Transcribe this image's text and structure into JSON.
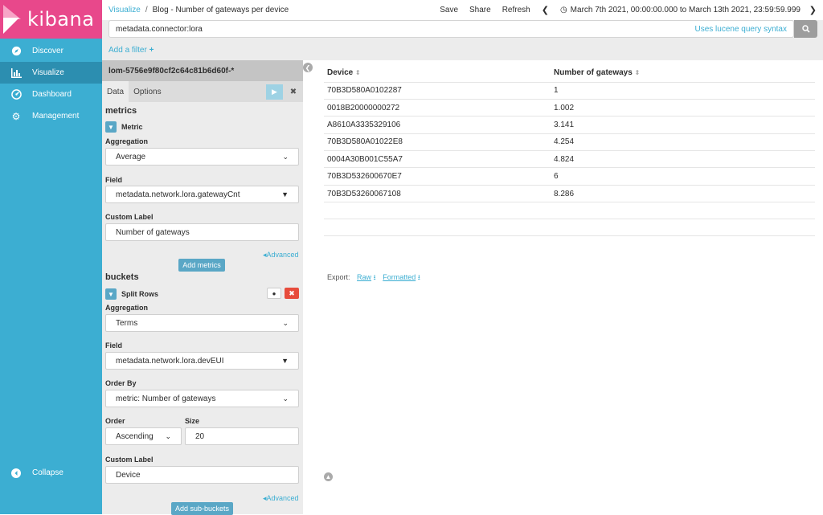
{
  "brand": {
    "name": "kibana"
  },
  "nav": [
    {
      "label": "Discover",
      "icon": "compass-icon"
    },
    {
      "label": "Visualize",
      "icon": "bar-chart-icon"
    },
    {
      "label": "Dashboard",
      "icon": "dashboard-icon"
    },
    {
      "label": "Management",
      "icon": "gear-icon"
    }
  ],
  "collapse_label": "Collapse",
  "breadcrumb": {
    "root": "Visualize",
    "separator": "/",
    "current": "Blog - Number of gateways per device"
  },
  "toolbar": {
    "save": "Save",
    "share": "Share",
    "refresh": "Refresh",
    "time_range": "March 7th 2021, 00:00:00.000 to March 13th 2021, 23:59:59.999"
  },
  "query": {
    "value": "metadata.connector:lora",
    "syntax_link": "Uses lucene query syntax"
  },
  "add_filter": "Add a filter",
  "editor": {
    "index_pattern": "lom-5756e9f80cf2c64c81b6d60f-*",
    "tabs": [
      "Data",
      "Options"
    ],
    "metrics_title": "metrics",
    "metric": {
      "header": "Metric",
      "aggregation_label": "Aggregation",
      "aggregation_value": "Average",
      "field_label": "Field",
      "field_value": "metadata.network.lora.gatewayCnt",
      "custom_label_label": "Custom Label",
      "custom_label_value": "Number of gateways",
      "advanced": "Advanced"
    },
    "add_metrics": "Add metrics",
    "buckets_title": "buckets",
    "bucket": {
      "header": "Split Rows",
      "aggregation_label": "Aggregation",
      "aggregation_value": "Terms",
      "field_label": "Field",
      "field_value": "metadata.network.lora.devEUI",
      "order_by_label": "Order By",
      "order_by_value": "metric: Number of gateways",
      "order_label": "Order",
      "order_value": "Ascending",
      "size_label": "Size",
      "size_value": "20",
      "custom_label_label": "Custom Label",
      "custom_label_value": "Device",
      "advanced": "Advanced"
    },
    "add_sub_buckets": "Add sub-buckets"
  },
  "table": {
    "columns": [
      "Device",
      "Number of gateways"
    ],
    "rows": [
      [
        "70B3D580A0102287",
        "1"
      ],
      [
        "0018B20000000272",
        "1.002"
      ],
      [
        "A8610A3335329106",
        "3.141"
      ],
      [
        "70B3D580A01022E8",
        "4.254"
      ],
      [
        "0004A30B001C55A7",
        "4.824"
      ],
      [
        "70B3D532600670E7",
        "6"
      ],
      [
        "70B3D53260067108",
        "8.286"
      ]
    ]
  },
  "export": {
    "label": "Export:",
    "raw": "Raw",
    "formatted": "Formatted"
  },
  "colors": {
    "sidebar": "#3caed2",
    "sidebar_active": "#2c8eb0",
    "logo_bg": "#e8488b",
    "accent": "#3caed2",
    "danger": "#e74c3c"
  }
}
